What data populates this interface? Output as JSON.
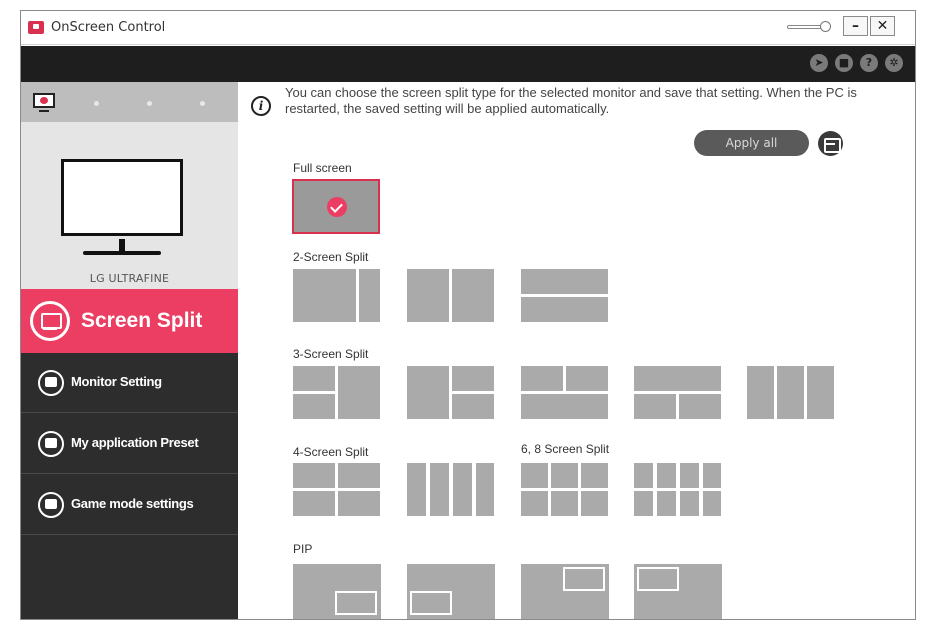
{
  "window": {
    "title": "OnScreen Control",
    "min_label": "–",
    "close_label": "✕"
  },
  "topbar": {
    "icons": [
      "pointer-icon",
      "display-icon",
      "help-icon",
      "settings-icon"
    ],
    "help_glyph": "?",
    "settings_glyph": "✲"
  },
  "sidebar": {
    "monitor_name": "LG ULTRAFINE",
    "active_menu": "Screen Split",
    "items": [
      {
        "label": "Monitor Setting"
      },
      {
        "label": "My application Preset"
      },
      {
        "label": "Game mode settings"
      }
    ]
  },
  "main": {
    "info_text": "You can choose the screen split type for the selected monitor and save that setting. When the PC is restarted, the saved setting will be applied automatically.",
    "apply_all_label": "Apply all",
    "sections": {
      "full": "Full screen",
      "two": "2-Screen Split",
      "three": "3-Screen Split",
      "four": "4-Screen Split",
      "six_eight": "6, 8 Screen Split",
      "pip": "PIP"
    }
  },
  "colors": {
    "accent": "#ec3d62",
    "sidebar": "#2d2d2d",
    "topbar": "#1e1e1e"
  }
}
